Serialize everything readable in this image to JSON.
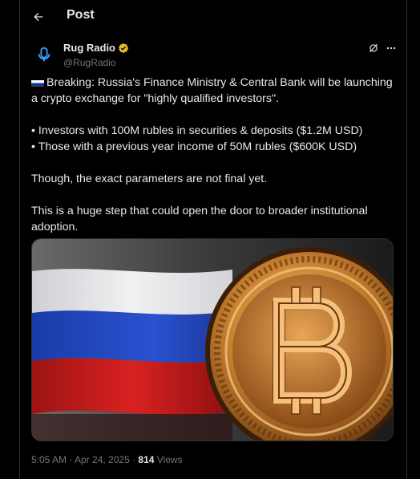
{
  "header": {
    "title": "Post"
  },
  "author": {
    "display_name": "Rug Radio",
    "handle": "@RugRadio",
    "verified_color": "#e8b82e"
  },
  "post": {
    "paragraph_1": "Breaking: Russia's Finance Ministry & Central Bank will be launching a crypto exchange for \"highly qualified investors\".",
    "bullet_1": "• Investors with 100M rubles in securities & deposits ($1.2M USD)",
    "bullet_2": "• Those with a previous year income of 50M rubles ($600K USD)",
    "paragraph_2": "Though, the exact parameters are not final yet.",
    "paragraph_3": "This is a huge step that could open the door to broader institutional adoption."
  },
  "meta": {
    "timestamp": "5:05 AM · Apr 24, 2025 · ",
    "views_count": "814",
    "views_label": " Views"
  },
  "colors": {
    "background": "#000000",
    "text": "#e7e9ea",
    "muted": "#71767b",
    "border": "#2f3336",
    "avatar_accent": "#3aa0ff"
  },
  "icons": {
    "back": "arrow-left-icon",
    "grok": "grok-icon",
    "more": "more-icon",
    "verified": "verified-badge-icon",
    "flag": "russia-flag-icon"
  }
}
